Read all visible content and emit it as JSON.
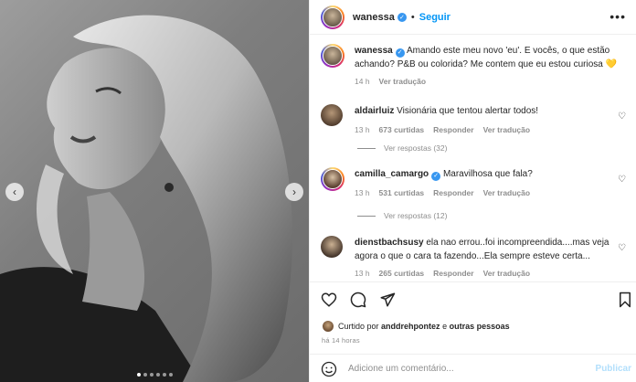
{
  "post": {
    "author": "wanessa",
    "follow_label": "Seguir",
    "separator": "•",
    "more": "•••"
  },
  "caption": {
    "username": "wanessa",
    "text": "Amando este meu novo 'eu'. E vocês, o que estão achando? P&B ou colorida? Me contem que eu estou curiosa 💛",
    "time": "14 h",
    "translate": "Ver tradução"
  },
  "comments": [
    {
      "username": "aldairluiz",
      "text": "Visionária que tentou alertar todos!",
      "time": "13 h",
      "likes": "673 curtidas",
      "reply": "Responder",
      "translate": "Ver tradução",
      "replies": "Ver respostas (32)"
    },
    {
      "username": "camilla_camargo",
      "text": "Maravilhosa que fala?",
      "time": "13 h",
      "likes": "531 curtidas",
      "reply": "Responder",
      "translate": "Ver tradução",
      "replies": "Ver respostas (12)"
    },
    {
      "username": "dienstbachsusy",
      "text": "ela nao errou..foi incompreendida....mas veja agora o que o cara ta fazendo...Ela sempre esteve certa...",
      "time": "13 h",
      "likes": "265 curtidas",
      "reply": "Responder",
      "translate": "Ver tradução"
    }
  ],
  "liked_by": {
    "prefix": "Curtido por",
    "user": "anddrehpontez",
    "connector": "e",
    "others": "outras pessoas"
  },
  "posted_time": "há 14 horas",
  "comment_box": {
    "placeholder": "Adicione um comentário...",
    "publish": "Publicar"
  },
  "carousel": {
    "prev": "‹",
    "next": "›",
    "dot_count": 6,
    "active_dot": 0
  },
  "colors": {
    "accent": "#0095f6",
    "verified": "#3897f0",
    "muted": "#8e8e8e",
    "publish_disabled": "#b2dffc"
  }
}
